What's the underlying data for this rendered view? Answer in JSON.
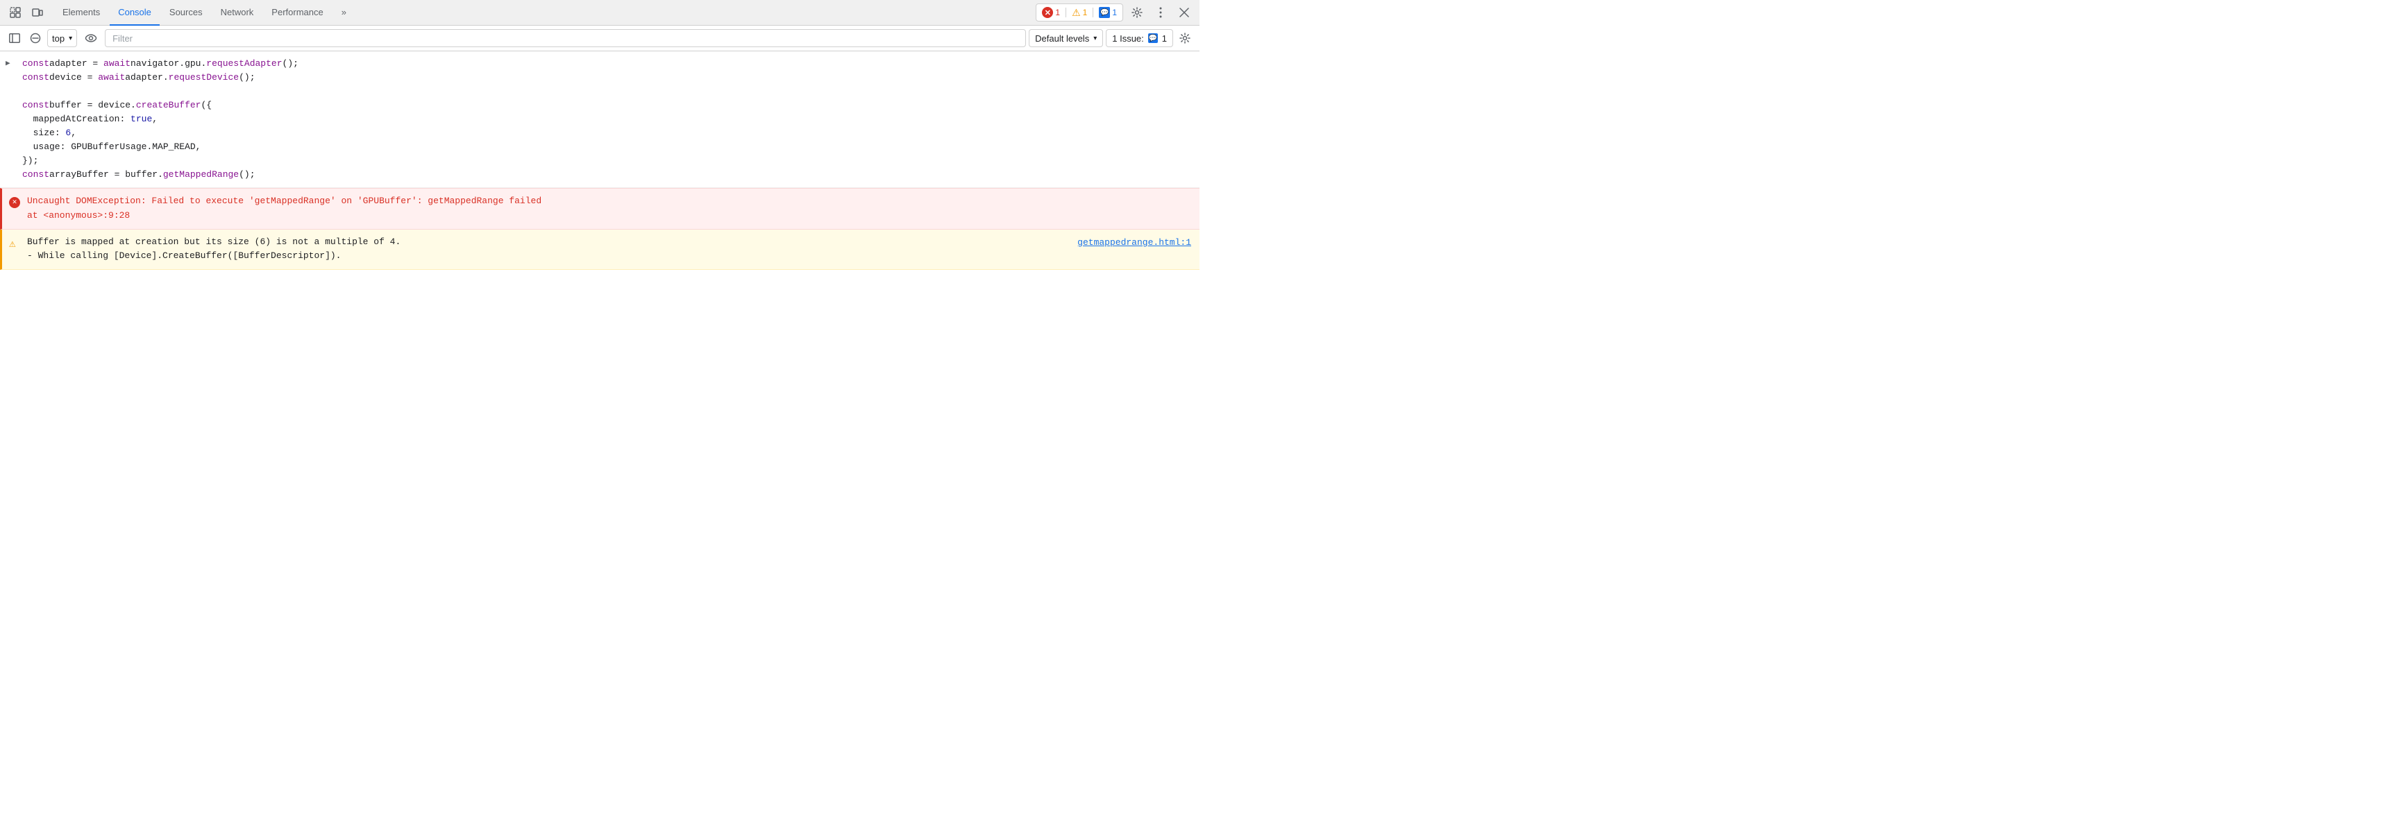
{
  "tabs": {
    "items": [
      {
        "label": "Elements",
        "active": false
      },
      {
        "label": "Console",
        "active": true
      },
      {
        "label": "Sources",
        "active": false
      },
      {
        "label": "Network",
        "active": false
      },
      {
        "label": "Performance",
        "active": false
      },
      {
        "label": "»",
        "active": false
      }
    ]
  },
  "toolbar": {
    "context_label": "top",
    "filter_placeholder": "Filter",
    "levels_label": "Default levels",
    "issues_label": "1 Issue:",
    "issues_count": "1"
  },
  "badges": {
    "errors": "1",
    "warnings": "1",
    "info": "1"
  },
  "console": {
    "lines": [
      {
        "type": "code",
        "content": "const adapter = await navigator.gpu.requestAdapter();"
      },
      {
        "type": "code",
        "content": "const device = await adapter.requestDevice();"
      },
      {
        "type": "code",
        "content": ""
      },
      {
        "type": "code",
        "content": "const buffer = device.createBuffer({"
      },
      {
        "type": "code",
        "content": "  mappedAtCreation: true,"
      },
      {
        "type": "code",
        "content": "  size: 6,"
      },
      {
        "type": "code",
        "content": "  usage: GPUBufferUsage.MAP_READ,"
      },
      {
        "type": "code",
        "content": "});"
      },
      {
        "type": "code",
        "content": "const arrayBuffer = buffer.getMappedRange();"
      }
    ],
    "error": {
      "message": "Uncaught DOMException: Failed to execute 'getMappedRange' on 'GPUBuffer': getMappedRange failed",
      "location": "    at <anonymous>:9:28"
    },
    "warning": {
      "message": "Buffer is mapped at creation but its size (6) is not a multiple of 4.",
      "sub_message": "  - While calling [Device].CreateBuffer([BufferDescriptor]).",
      "link_text": "getmappedrange.html:1"
    }
  }
}
